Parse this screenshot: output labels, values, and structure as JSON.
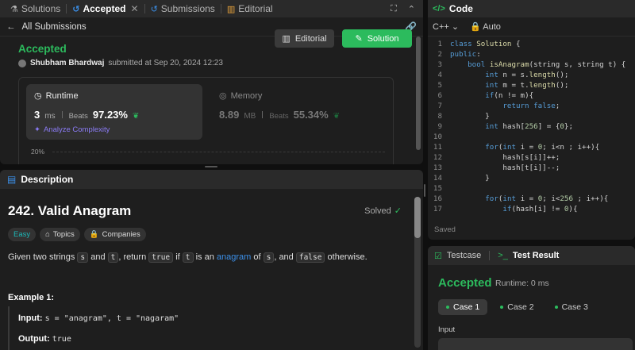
{
  "submission": {
    "tabs": [
      {
        "label": "Solutions",
        "icon": "flask-icon"
      },
      {
        "label": "Accepted",
        "icon": "history-icon"
      },
      {
        "label": "Submissions",
        "icon": "history-icon"
      },
      {
        "label": "Editorial",
        "icon": "book-icon"
      }
    ],
    "back_label": "All Submissions",
    "status": "Accepted",
    "user": "Shubham Bhardwaj",
    "submitted_text": "submitted at Sep 20, 2024 12:23",
    "editorial_btn": "Editorial",
    "solution_btn": "Solution",
    "runtime": {
      "title": "Runtime",
      "value": "3",
      "unit": "ms",
      "beats_label": "Beats",
      "beats_pct": "97.23%",
      "analyze": "Analyze Complexity"
    },
    "memory": {
      "title": "Memory",
      "value": "8.89",
      "unit": "MB",
      "beats_label": "Beats",
      "beats_pct": "55.34%"
    },
    "chart_tick": "20%"
  },
  "description": {
    "header": "Description",
    "title": "242. Valid Anagram",
    "solved": "Solved",
    "chips": {
      "difficulty": "Easy",
      "topics": "Topics",
      "companies": "Companies"
    },
    "text": {
      "p1": "Given two strings ",
      "s": "s",
      "p2": " and ",
      "t": "t",
      "p3": ", return ",
      "true_code": "true",
      "p4": " if ",
      "t2": "t",
      "p5": " is an ",
      "anagram": "anagram",
      "p6": " of ",
      "s2": "s",
      "p7": ", and ",
      "false_code": "false",
      "p8": " otherwise."
    },
    "example_title": "Example 1:",
    "input_label": "Input:",
    "input_value": "s = \"anagram\", t = \"nagaram\"",
    "output_label": "Output:",
    "output_value": "true"
  },
  "code": {
    "header": "Code",
    "language": "C++",
    "mode": "Auto",
    "saved": "Saved",
    "lines": [
      {
        "n": "1",
        "s": [
          [
            "kw",
            "class "
          ],
          [
            "fn",
            "Solution "
          ],
          [
            "id",
            "{"
          ]
        ]
      },
      {
        "n": "2",
        "s": [
          [
            "kw",
            "public"
          ],
          [
            "id",
            ":"
          ]
        ]
      },
      {
        "n": "3",
        "s": [
          [
            "id",
            "    "
          ],
          [
            "ty",
            "bool "
          ],
          [
            "fn",
            "isAnagram"
          ],
          [
            "id",
            "(string s, string t) {"
          ]
        ]
      },
      {
        "n": "4",
        "s": [
          [
            "id",
            "        "
          ],
          [
            "ty",
            "int "
          ],
          [
            "id",
            "n = s."
          ],
          [
            "fn",
            "length"
          ],
          [
            "id",
            "();"
          ]
        ]
      },
      {
        "n": "5",
        "s": [
          [
            "id",
            "        "
          ],
          [
            "ty",
            "int "
          ],
          [
            "id",
            "m = t."
          ],
          [
            "fn",
            "length"
          ],
          [
            "id",
            "();"
          ]
        ]
      },
      {
        "n": "6",
        "s": [
          [
            "id",
            "        "
          ],
          [
            "kw",
            "if"
          ],
          [
            "id",
            "(n != m){"
          ]
        ]
      },
      {
        "n": "7",
        "s": [
          [
            "id",
            "            "
          ],
          [
            "kw",
            "return "
          ],
          [
            "kw",
            "false"
          ],
          [
            "id",
            ";"
          ]
        ]
      },
      {
        "n": "8",
        "s": [
          [
            "id",
            "        }"
          ]
        ]
      },
      {
        "n": "9",
        "s": [
          [
            "id",
            "        "
          ],
          [
            "ty",
            "int "
          ],
          [
            "id",
            "hash["
          ],
          [
            "nm",
            "256"
          ],
          [
            "id",
            "] = {"
          ],
          [
            "nm",
            "0"
          ],
          [
            "id",
            "};"
          ]
        ]
      },
      {
        "n": "10",
        "s": [
          [
            "id",
            ""
          ]
        ]
      },
      {
        "n": "11",
        "s": [
          [
            "id",
            "        "
          ],
          [
            "kw",
            "for"
          ],
          [
            "id",
            "("
          ],
          [
            "ty",
            "int "
          ],
          [
            "id",
            "i = "
          ],
          [
            "nm",
            "0"
          ],
          [
            "id",
            "; i<n ; i++){"
          ]
        ]
      },
      {
        "n": "12",
        "s": [
          [
            "id",
            "            hash[s[i]]++;"
          ]
        ]
      },
      {
        "n": "13",
        "s": [
          [
            "id",
            "            hash[t[i]]--;"
          ]
        ]
      },
      {
        "n": "14",
        "s": [
          [
            "id",
            "        }"
          ]
        ]
      },
      {
        "n": "15",
        "s": [
          [
            "id",
            ""
          ]
        ]
      },
      {
        "n": "16",
        "s": [
          [
            "id",
            "        "
          ],
          [
            "kw",
            "for"
          ],
          [
            "id",
            "("
          ],
          [
            "ty",
            "int "
          ],
          [
            "id",
            "i = "
          ],
          [
            "nm",
            "0"
          ],
          [
            "id",
            "; i<"
          ],
          [
            "nm",
            "256"
          ],
          [
            "id",
            " ; i++){"
          ]
        ]
      },
      {
        "n": "17",
        "s": [
          [
            "id",
            "            "
          ],
          [
            "kw",
            "if"
          ],
          [
            "id",
            "(hash[i] != "
          ],
          [
            "nm",
            "0"
          ],
          [
            "id",
            "){"
          ]
        ]
      }
    ]
  },
  "test": {
    "testcase_tab": "Testcase",
    "result_tab": "Test Result",
    "status": "Accepted",
    "runtime": "Runtime: 0 ms",
    "cases": [
      "Case 1",
      "Case 2",
      "Case 3"
    ],
    "input_label": "Input"
  },
  "colors": {
    "accent_green": "#2cbb5d",
    "link_blue": "#3b8fe8",
    "easy_teal": "#1cb8b8"
  }
}
